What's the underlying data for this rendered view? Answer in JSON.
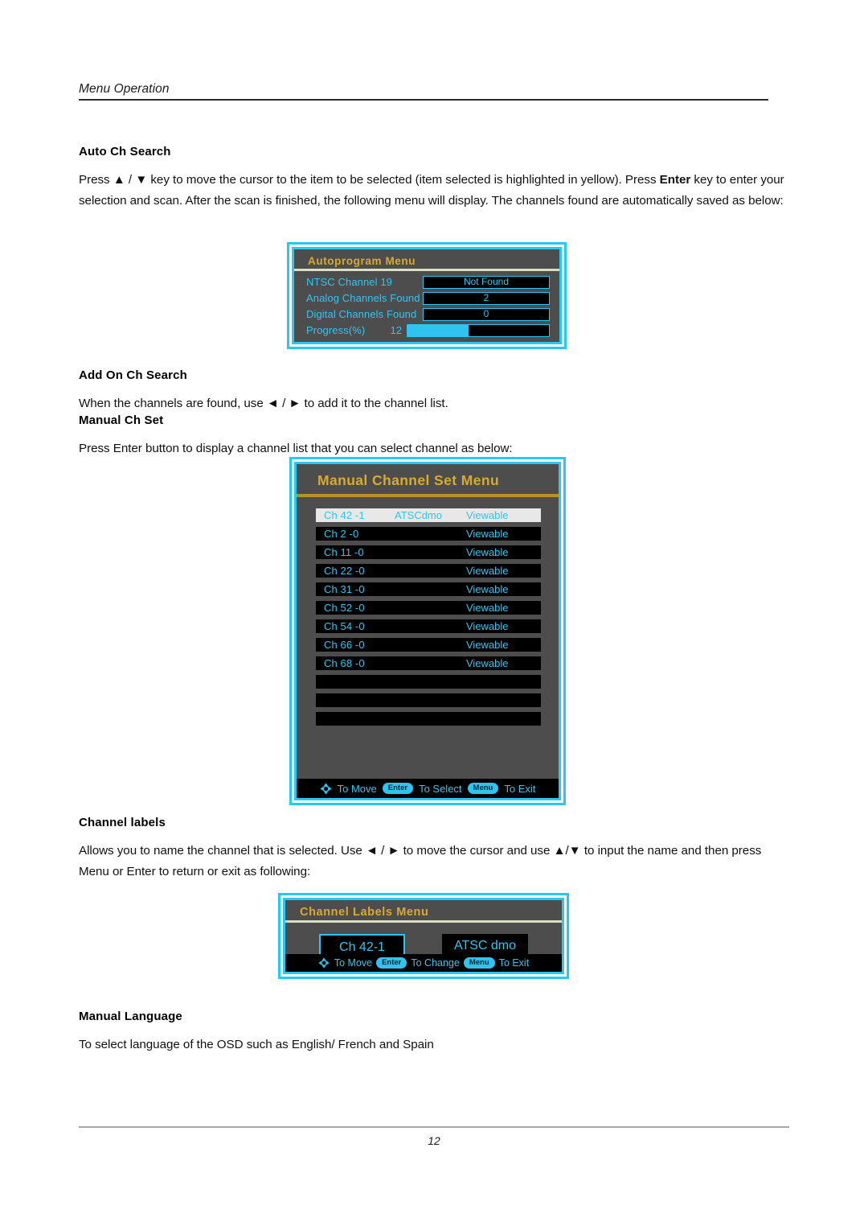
{
  "header": {
    "running_head": "Menu Operation"
  },
  "sections": {
    "auto_ch_search": {
      "heading": "Auto Ch Search",
      "body_part1": "Press ▲ / ▼ key to move the cursor to the item to be selected (item selected is highlighted in yellow). Press ",
      "body_bold": "Enter",
      "body_part2": " key to enter your selection and scan. After the scan is finished, the following menu will display. The channels found are automatically saved as below:"
    },
    "add_on_ch_search": {
      "heading": "Add On Ch Search",
      "body": "When the channels are found, use ◄ / ► to add it  to the channel list."
    },
    "manual_ch_set": {
      "heading": "Manual Ch Set",
      "body": "Press Enter button to display a channel list that you can select channel as below:"
    },
    "channel_labels": {
      "heading": "Channel labels",
      "body": "Allows you to name the channel that is selected. Use  ◄ / ► to move the cursor and use ▲/▼ to input the name and then press Menu or Enter to return or exit as following:"
    },
    "manual_language": {
      "heading": "Manual Language",
      "body": "To select language of the OSD such as English/ French and Spain"
    }
  },
  "autoprogram_menu": {
    "title": "Autoprogram Menu",
    "rows": [
      {
        "label": "NTSC Channel 19",
        "value": "Not Found"
      },
      {
        "label": "Analog Channels Found",
        "value": "2"
      },
      {
        "label": "Digital Channels Found",
        "value": "0"
      }
    ],
    "progress": {
      "label": "Progress(%)",
      "value": "12",
      "fill_percent": 43
    }
  },
  "manual_channel_set_menu": {
    "title": "Manual Channel Set  Menu",
    "rows": [
      {
        "channel": "Ch 42 -1",
        "name": "ATSCdmo",
        "state": "Viewable",
        "selected": true
      },
      {
        "channel": "Ch 2 -0",
        "name": "",
        "state": "Viewable",
        "selected": false
      },
      {
        "channel": "Ch 11 -0",
        "name": "",
        "state": "Viewable",
        "selected": false
      },
      {
        "channel": "Ch 22 -0",
        "name": "",
        "state": "Viewable",
        "selected": false
      },
      {
        "channel": "Ch 31 -0",
        "name": "",
        "state": "Viewable",
        "selected": false
      },
      {
        "channel": "Ch 52 -0",
        "name": "",
        "state": "Viewable",
        "selected": false
      },
      {
        "channel": "Ch 54 -0",
        "name": "",
        "state": "Viewable",
        "selected": false
      },
      {
        "channel": "Ch 66 -0",
        "name": "",
        "state": "Viewable",
        "selected": false
      },
      {
        "channel": "Ch 68 -0",
        "name": "",
        "state": "Viewable",
        "selected": false
      },
      {
        "channel": "",
        "name": "",
        "state": "",
        "selected": false
      },
      {
        "channel": "",
        "name": "",
        "state": "",
        "selected": false
      },
      {
        "channel": "",
        "name": "",
        "state": "",
        "selected": false
      }
    ],
    "hints": {
      "move_label": "To Move",
      "enter_key": "Enter",
      "select_label": "To Select",
      "menu_key": "Menu",
      "exit_label": "To Exit"
    }
  },
  "channel_labels_menu": {
    "title": "Channel Labels  Menu",
    "channel_box": "Ch 42-1",
    "name_box": "ATSC dmo",
    "hints": {
      "move_label": "To Move",
      "enter_key": "Enter",
      "change_label": "To Change",
      "menu_key": "Menu",
      "exit_label": "To Exit"
    }
  },
  "footer": {
    "page_number": "12"
  },
  "colors": {
    "osd_cyan": "#2fc3f0",
    "osd_text_cyan": "#35c4ef",
    "osd_gold": "#d8aa2e",
    "osd_panel": "#4d4d4d",
    "osd_black": "#000000",
    "selected_row": "#e8e8e8"
  }
}
